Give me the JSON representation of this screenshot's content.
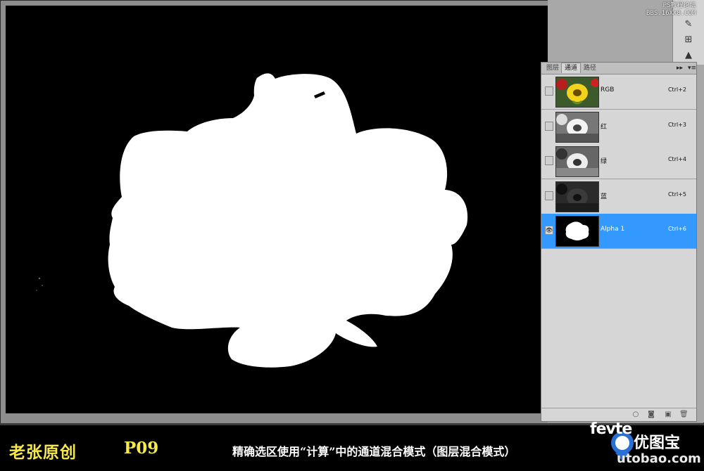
{
  "watermark": {
    "line1": "PS教程论坛",
    "line2": "BBS.16XX8.COM"
  },
  "panel": {
    "tabs": [
      {
        "label": "图层",
        "active": false
      },
      {
        "label": "通道",
        "active": true
      },
      {
        "label": "路径",
        "active": false
      }
    ],
    "menu_icon": "▸▸",
    "options_icon": "▾≡"
  },
  "channels": [
    {
      "name": "RGB",
      "shortcut": "Ctrl+2",
      "visible": false,
      "selected": false,
      "thumb": "color"
    },
    {
      "name": "红",
      "shortcut": "Ctrl+3",
      "visible": false,
      "selected": false,
      "thumb": "red"
    },
    {
      "name": "绿",
      "shortcut": "Ctrl+4",
      "visible": false,
      "selected": false,
      "thumb": "green"
    },
    {
      "name": "蓝",
      "shortcut": "Ctrl+5",
      "visible": false,
      "selected": false,
      "thumb": "blue"
    },
    {
      "name": "Alpha 1",
      "shortcut": "Ctrl+6",
      "visible": true,
      "selected": true,
      "thumb": "alpha"
    }
  ],
  "visibility_icon": "eye-icon",
  "footer_icons": [
    "load-selection-icon",
    "save-selection-icon",
    "new-channel-icon",
    "delete-channel-icon"
  ],
  "caption": {
    "author": "老张原创",
    "page": "P09",
    "text": "精确选区使用“计算”中的通道混合模式（图层混合模式）"
  },
  "brand": {
    "fevte": "fevte",
    "name": "优图宝",
    "url": "utobao.com"
  },
  "colors": {
    "caption_yellow": "#f6e94a",
    "selection_blue": "#3399ff",
    "canvas_bg": "#000000"
  }
}
